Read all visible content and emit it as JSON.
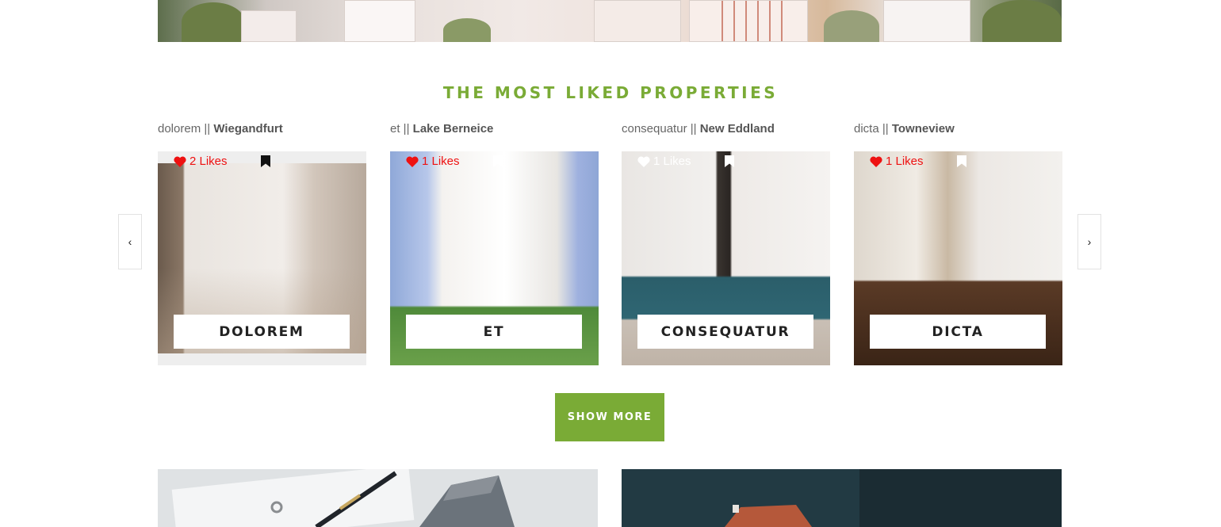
{
  "section": {
    "title": "THE MOST LIKED PROPERTIES",
    "show_more_label": "SHOW MORE"
  },
  "nav": {
    "prev_icon": "‹",
    "next_icon": "›"
  },
  "colors": {
    "accent": "#7aab36",
    "like_red": "#e11111",
    "white": "#ffffff"
  },
  "properties": [
    {
      "subtitle": "dolorem",
      "separator": " || ",
      "city": "Wiegandfurt",
      "likes": "2 Likes",
      "liked": true,
      "name": "DOLOREM"
    },
    {
      "subtitle": "et",
      "separator": " || ",
      "city": "Lake Berneice",
      "likes": "1 Likes",
      "liked": true,
      "name": "ET"
    },
    {
      "subtitle": "consequatur",
      "separator": " || ",
      "city": "New Eddland",
      "likes": "1 Likes",
      "liked": false,
      "name": "CONSEQUATUR"
    },
    {
      "subtitle": "dicta",
      "separator": " || ",
      "city": "Towneview",
      "likes": "1 Likes",
      "liked": true,
      "name": "DICTA"
    }
  ],
  "icons": {
    "heart": "heart-icon",
    "bookmark": "bookmark-icon",
    "prev": "chevron-left-icon",
    "next": "chevron-right-icon"
  }
}
